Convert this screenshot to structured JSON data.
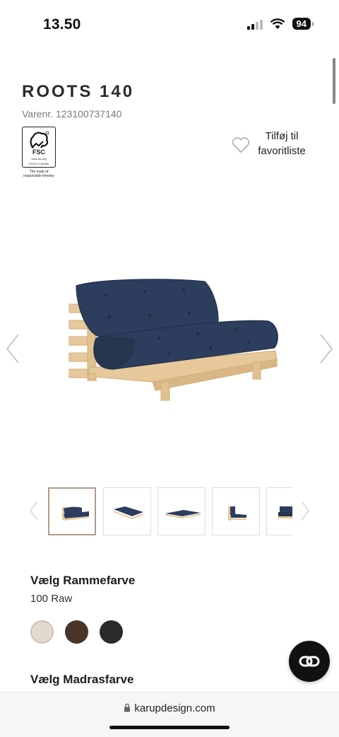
{
  "status_bar": {
    "time": "13.50",
    "battery": "94"
  },
  "product": {
    "title": "ROOTS 140",
    "sku_label": "Varenr. 123100737140"
  },
  "fsc": {
    "word": "FSC",
    "site": "www.fsc.org",
    "code": "FSC® C108366",
    "caption_line1": "The mark of",
    "caption_line2": "responsible forestry"
  },
  "favorite": {
    "line1": "Tilføj til",
    "line2": "favoritliste"
  },
  "colors": {
    "mattress": "#2d3d5e",
    "mattress_shadow": "#22304c",
    "wood": "#e6c89a",
    "wood_dark": "#cfae7c",
    "thumb_active_border": "#b59a86"
  },
  "frame_section": {
    "title": "Vælg Rammefarve",
    "selected": "100 Raw",
    "swatches": [
      {
        "name": "raw",
        "color": "#e3d9cd"
      },
      {
        "name": "brown",
        "color": "#4a3428"
      },
      {
        "name": "black",
        "color": "#2a2a2a"
      }
    ]
  },
  "mattress_section": {
    "title": "Vælg Madrasfarve"
  },
  "browser": {
    "url": "karupdesign.com"
  }
}
